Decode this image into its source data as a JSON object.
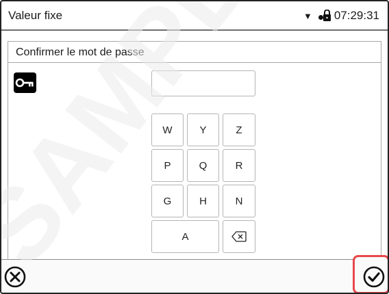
{
  "header": {
    "title": "Valeur fixe",
    "time": "07:29:31",
    "dropdown_icon": "caret-down-icon",
    "status_icon": "lock-icon"
  },
  "dialog": {
    "title": "Confirmer le mot de passe",
    "icon": "key-icon",
    "password_value": ""
  },
  "keypad": {
    "keys": [
      "W",
      "Y",
      "Z",
      "P",
      "Q",
      "R",
      "G",
      "H",
      "N",
      "A"
    ],
    "backspace_icon": "backspace-icon"
  },
  "footer": {
    "cancel_icon": "cancel-circle-icon",
    "confirm_icon": "confirm-check-icon",
    "highlight_color": "#e8474b"
  },
  "watermark": "SAMPLE"
}
